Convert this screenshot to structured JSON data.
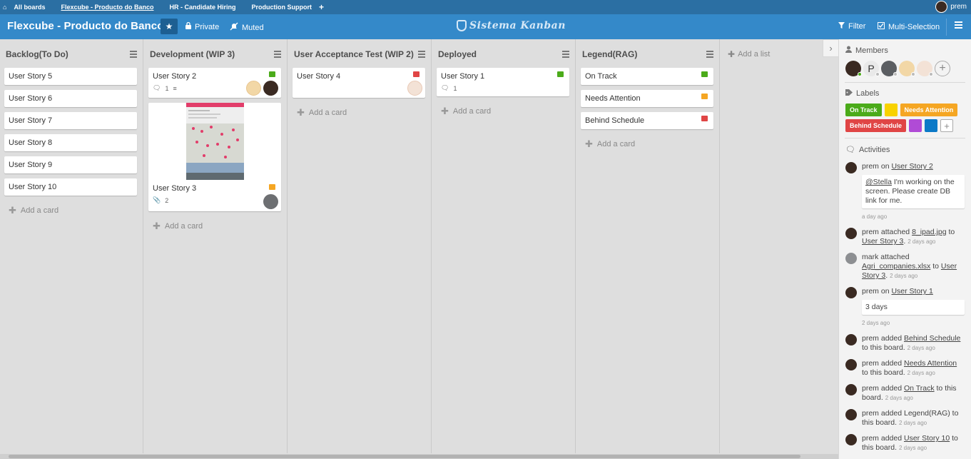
{
  "topbar": {
    "items": [
      {
        "label": "All boards"
      },
      {
        "label": "Flexcube - Producto do Banco"
      },
      {
        "label": "HR - Candidate Hiring"
      },
      {
        "label": "Production Support"
      }
    ],
    "add_symbol": "+",
    "user_name": "prem"
  },
  "header": {
    "board_title": "Flexcube - Producto do Banco",
    "private_label": "Private",
    "muted_label": "Muted",
    "logo_text": "Sistema Kanban",
    "filter_label": "Filter",
    "multi_selection_label": "Multi-Selection"
  },
  "lists": [
    {
      "title": "Backlog(To Do)",
      "cards": [
        {
          "title": "User Story 5"
        },
        {
          "title": "User Story 6"
        },
        {
          "title": "User Story 7"
        },
        {
          "title": "User Story 8"
        },
        {
          "title": "User Story 9"
        },
        {
          "title": "User Story 10"
        }
      ],
      "add_card": "Add a card"
    },
    {
      "title": "Development (WIP 3)",
      "cards": [
        {
          "title": "User Story 2",
          "label_color": "#4bab1a",
          "comments": "1"
        },
        {
          "title": "User Story 3",
          "label_color": "#f5a623",
          "attachments": "2"
        }
      ],
      "add_card": "Add a card"
    },
    {
      "title": "User Acceptance Test (WIP 2)",
      "cards": [
        {
          "title": "User Story 4",
          "label_color": "#e04545"
        }
      ],
      "add_card": "Add a card"
    },
    {
      "title": "Deployed",
      "cards": [
        {
          "title": "User Story 1",
          "label_color": "#4bab1a",
          "comments": "1"
        }
      ],
      "add_card": "Add a card"
    },
    {
      "title": "Legend(RAG)",
      "cards": [
        {
          "title": "On Track",
          "label_color": "#4bab1a"
        },
        {
          "title": "Needs Attention",
          "label_color": "#f5a623"
        },
        {
          "title": "Behind Schedule",
          "label_color": "#e04545"
        }
      ],
      "add_card": "Add a card"
    }
  ],
  "add_list": "Add a list",
  "sidebar": {
    "members_title": "Members",
    "member_initial": "P",
    "labels_title": "Labels",
    "labels": [
      {
        "name": "On Track",
        "color": "#4bab1a"
      },
      {
        "name": "",
        "color": "#f8d200"
      },
      {
        "name": "Needs Attention",
        "color": "#f5a623"
      },
      {
        "name": "Behind Schedule",
        "color": "#e04545"
      },
      {
        "name": "",
        "color": "#b04bd6"
      },
      {
        "name": "",
        "color": "#0b79c7"
      }
    ],
    "activities_title": "Activities",
    "activities": [
      {
        "user": "prem",
        "pre": "on",
        "link": "User Story 2",
        "post": "",
        "link2": "",
        "post2": "",
        "time": "",
        "comment_mention": "@Stella",
        "comment": " I'm working on the screen. Please create DB link for me.",
        "under": "a day ago"
      },
      {
        "user": "prem",
        "pre": "attached",
        "link": "8_ipad.jpg",
        "post": "to",
        "link2": "User Story 3",
        "post2": ".",
        "time": "2 days ago"
      },
      {
        "user": "mark",
        "pre": "attached",
        "link": "Agri_companies.xlsx",
        "post": "to",
        "link2": "User Story 3",
        "post2": ".",
        "time": "2 days ago"
      },
      {
        "user": "prem",
        "pre": "on",
        "link": "User Story 1",
        "post": "",
        "link2": "",
        "post2": "",
        "time": "",
        "comment": "3 days",
        "under": "2 days ago"
      },
      {
        "user": "prem",
        "pre": "added",
        "link": "Behind Schedule",
        "post": "to this board.",
        "time": "2 days ago"
      },
      {
        "user": "prem",
        "pre": "added",
        "link": "Needs Attention",
        "post": "to this board.",
        "time": "2 days ago"
      },
      {
        "user": "prem",
        "pre": "added",
        "link": "On Track",
        "post": "to this board.",
        "time": "2 days ago"
      },
      {
        "user": "prem",
        "pre": "added Legend(RAG) to this board.",
        "link": "",
        "post": "",
        "time": "2 days ago"
      },
      {
        "user": "prem",
        "pre": "added",
        "link": "User Story 10",
        "post": "to this board.",
        "time": "2 days ago"
      }
    ]
  }
}
